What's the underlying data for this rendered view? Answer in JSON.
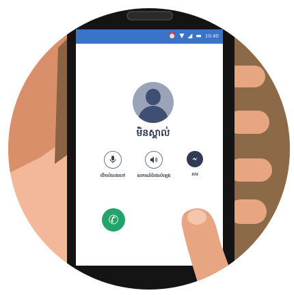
{
  "status_bar": {
    "icons": [
      "alarm-icon",
      "wifi-icon",
      "signal-icon",
      "battery-icon"
    ],
    "time": "10:40"
  },
  "caller": {
    "name": "មិនស្គាល់",
    "avatar": "person-icon"
  },
  "actions": [
    {
      "label": "បើកសំលេងហៅ",
      "icon": "microphone-icon"
    },
    {
      "label": "ឧបករណ៍បំពងសំឡេង",
      "icon": "speaker-icon"
    },
    {
      "label": "សារ",
      "icon": "messenger-icon"
    }
  ],
  "colors": {
    "status_bar": "#3a74c9",
    "answer": "#21a36b",
    "decline": "#e6402c",
    "background_circle": "#f2b899",
    "phone_body": "#141414"
  }
}
